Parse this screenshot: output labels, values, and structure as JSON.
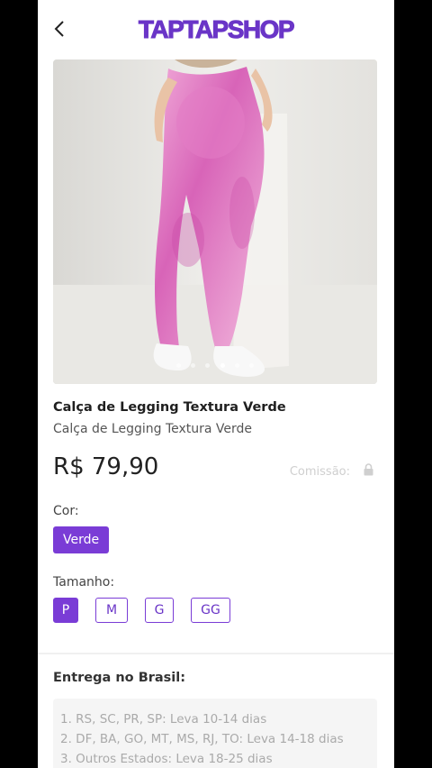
{
  "brand": {
    "logo_text": "TAPTAPSHOP",
    "accent": "#7a3cd6"
  },
  "header": {
    "back_icon": "chevron-left-icon"
  },
  "gallery": {
    "dot_count": 6,
    "active_index": 3
  },
  "product": {
    "title": "Calça de Legging Textura Verde",
    "subtitle": "Calça de Legging Textura Verde",
    "price": "R$ 79,90",
    "commission_label": "Comissão:",
    "commission_icon": "lock-icon"
  },
  "options": {
    "color_label": "Cor:",
    "color_value": "Verde",
    "size_label": "Tamanho:",
    "sizes": [
      "P",
      "M",
      "G",
      "GG"
    ],
    "selected_size": "P"
  },
  "delivery": {
    "title": "Entrega no Brasil:",
    "lines": [
      "1. RS, SC, PR, SP: Leva 10-14 dias",
      "2. DF, BA, GO, MT, MS, RJ, TO: Leva 14-18 dias",
      "3. Outros Estados: Leva 18-25 dias"
    ]
  }
}
